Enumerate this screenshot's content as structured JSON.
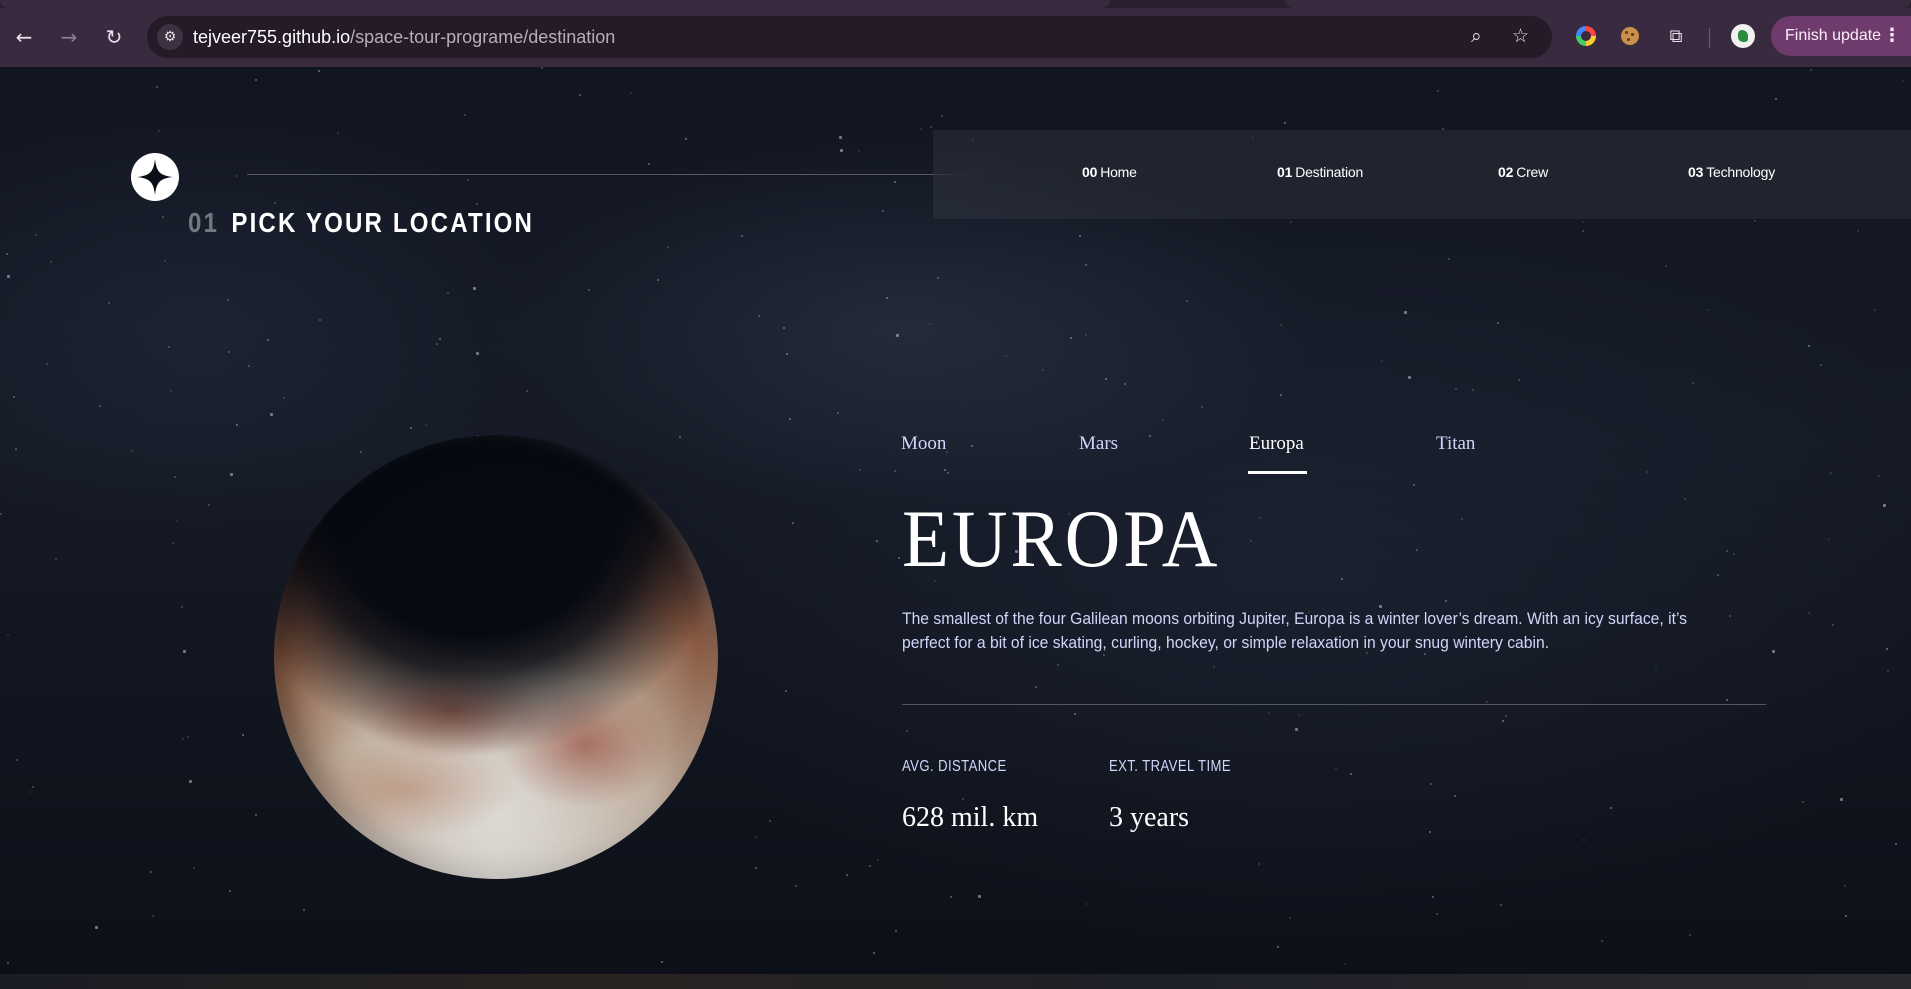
{
  "browser": {
    "url_host": "tejveer755.github.io",
    "url_path": "/space-tour-programe/destination",
    "update_button_label": "Finish update"
  },
  "nav": {
    "items": [
      {
        "num": "00",
        "label": "Home"
      },
      {
        "num": "01",
        "label": "Destination"
      },
      {
        "num": "02",
        "label": "Crew"
      },
      {
        "num": "03",
        "label": "Technology"
      }
    ]
  },
  "section": {
    "number": "01",
    "title": "PICK YOUR LOCATION"
  },
  "tabs": [
    "Moon",
    "Mars",
    "Europa",
    "Titan"
  ],
  "active_tab": "Europa",
  "destination": {
    "name": "EUROPA",
    "description": "The smallest of the four Galilean moons orbiting Jupiter, Europa is a winter lover’s dream. With an icy surface, it’s perfect for a bit of ice skating, curling, hockey, or simple relaxation in your snug wintery cabin.",
    "stats": [
      {
        "label": "AVG. DISTANCE",
        "value": "628 mil. km"
      },
      {
        "label": "EXT. TRAVEL TIME",
        "value": "3 years"
      }
    ]
  },
  "colors": {
    "background": "#0b0d17",
    "accent_light": "#d0d6f9",
    "white": "#ffffff",
    "update_button": "#6e3b6c"
  }
}
